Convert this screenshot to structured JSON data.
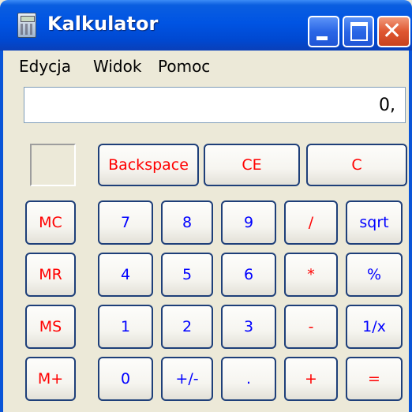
{
  "window": {
    "title": "Kalkulator",
    "app_icon": "calculator-icon"
  },
  "titlebar_buttons": {
    "minimize": "minimize-icon",
    "maximize": "maximize-icon",
    "close_glyph": "✕"
  },
  "menu": {
    "edit": "Edycja",
    "view": "Widok",
    "help": "Pomoc"
  },
  "display": {
    "value": "0,"
  },
  "colors": {
    "operator": "#ff0000",
    "digit": "#0000ff",
    "titlebar": "#0054e3",
    "window_bg": "#ece9d8"
  },
  "buttons": {
    "backspace": "Backspace",
    "ce": "CE",
    "c": "C",
    "mc": "MC",
    "mr": "MR",
    "ms": "MS",
    "mplus": "M+",
    "d7": "7",
    "d8": "8",
    "d9": "9",
    "div": "/",
    "sqrt": "sqrt",
    "d4": "4",
    "d5": "5",
    "d6": "6",
    "mul": "*",
    "pct": "%",
    "d1": "1",
    "d2": "2",
    "d3": "3",
    "sub": "-",
    "inv": "1/x",
    "d0": "0",
    "sign": "+/-",
    "dot": ".",
    "add": "+",
    "eq": "="
  }
}
